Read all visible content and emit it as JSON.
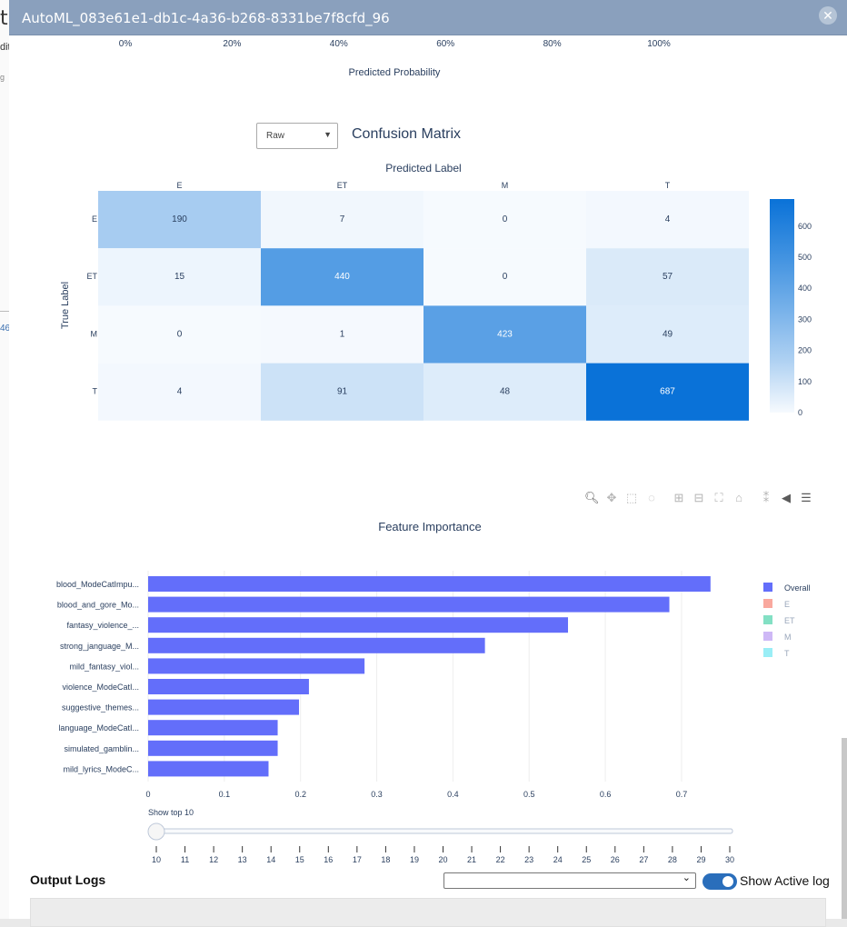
{
  "background": {
    "letter": "t",
    "dit": "dit",
    "mini": "g",
    "mini2": "46"
  },
  "window": {
    "title": "AutoML_083e61e1-db1c-4a36-b268-8331be7f8cfd_96",
    "close_icon": "close-icon"
  },
  "probability_axis": {
    "ticks": [
      "0%",
      "20%",
      "40%",
      "60%",
      "80%",
      "100%"
    ],
    "label": "Predicted Probability"
  },
  "confusion": {
    "dropdown_value": "Raw",
    "title": "Confusion Matrix",
    "x_title": "Predicted Label",
    "y_title": "True Label",
    "labels": [
      "E",
      "ET",
      "M",
      "T"
    ],
    "matrix": [
      [
        190,
        7,
        0,
        4
      ],
      [
        15,
        440,
        0,
        57
      ],
      [
        0,
        1,
        423,
        49
      ],
      [
        4,
        91,
        48,
        687
      ]
    ],
    "colorbar_ticks": [
      "0",
      "100",
      "200",
      "300",
      "400",
      "500",
      "600"
    ],
    "colorscale": [
      "#f6fafe",
      "#0a72d8"
    ],
    "zmax": 687
  },
  "toolbar": {
    "icons": [
      "zoom-icon",
      "pan-icon",
      "box-select-icon",
      "lasso-select-icon",
      "zoom-in-icon",
      "zoom-out-icon",
      "autoscale-icon",
      "reset-axes-icon",
      "spike-lines-icon",
      "hover-closest-icon",
      "hover-compare-icon"
    ]
  },
  "chart_data": {
    "type": "bar",
    "orientation": "horizontal",
    "title": "Feature Importance",
    "categories": [
      "blood_ModeCatImpu...",
      "blood_and_gore_Mo...",
      "fantasy_violence_...",
      "strong_janguage_M...",
      "mild_fantasy_viol...",
      "violence_ModeCatI...",
      "suggestive_themes...",
      "language_ModeCatI...",
      "simulated_gamblin...",
      "mild_lyrics_ModeC..."
    ],
    "series": [
      {
        "name": "Overall",
        "values": [
          0.738,
          0.684,
          0.551,
          0.442,
          0.284,
          0.211,
          0.198,
          0.17,
          0.17,
          0.158
        ]
      }
    ],
    "xlim": [
      0,
      0.78
    ],
    "xticks": [
      0,
      0.1,
      0.2,
      0.3,
      0.4,
      0.5,
      0.6,
      0.7
    ],
    "legend": [
      "Overall",
      "E",
      "ET",
      "M",
      "T"
    ],
    "legend_colors": [
      "#636efa",
      "#f9a89e",
      "#83e0c4",
      "#ceb8f6",
      "#9aeef6"
    ],
    "legend_placement": "right",
    "grid": true
  },
  "slider": {
    "label": "Show top 10",
    "value": 10,
    "ticks": [
      "10",
      "11",
      "12",
      "13",
      "14",
      "15",
      "16",
      "17",
      "18",
      "19",
      "20",
      "21",
      "22",
      "23",
      "24",
      "25",
      "26",
      "27",
      "28",
      "29",
      "30"
    ]
  },
  "output": {
    "title": "Output Logs",
    "select_value": "",
    "select_arrow": "⌄",
    "toggle_label": "Show Active log"
  }
}
